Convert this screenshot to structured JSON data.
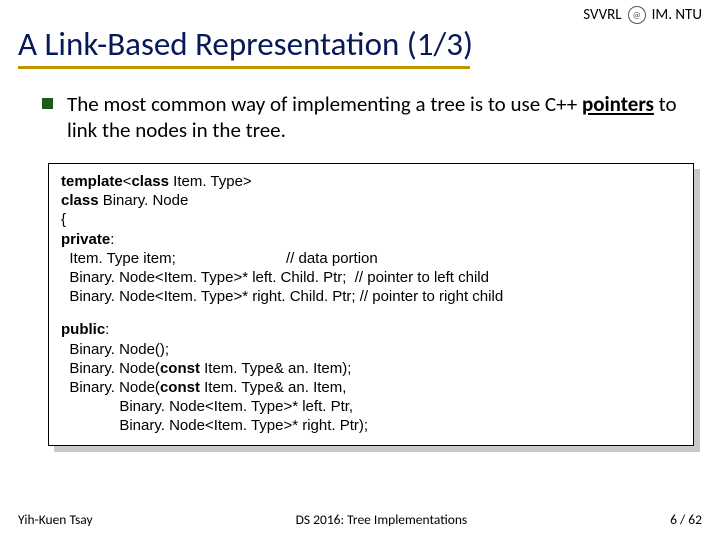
{
  "header": {
    "lab": "SVVRL",
    "at_logo": "@",
    "org": "IM. NTU",
    "title": "A Link-Based Representation (1/3)"
  },
  "bullet": {
    "pre": "The most common way of implementing a tree is to use C++ ",
    "bold": "pointers",
    "post": " to link the nodes in the tree."
  },
  "code": {
    "l1a": "template",
    "l1b": "<",
    "l1c": "class",
    "l1d": " Item. Type>",
    "l2a": "class",
    "l2b": " Binary. Node",
    "l3": "{",
    "l4": "private",
    "l4b": ":",
    "l5a": "  Item. Type item;",
    "l5b": "// data portion",
    "l6": "  Binary. Node<Item. Type>* left. Child. Ptr;  // pointer to left child",
    "l7": "  Binary. Node<Item. Type>* right. Child. Ptr; // pointer to right child",
    "l8": "public",
    "l8b": ":",
    "l9": "  Binary. Node();",
    "l10a": "  Binary. Node(",
    "l10b": "const",
    "l10c": " Item. Type& an. Item);",
    "l11a": "  Binary. Node(",
    "l11b": "const",
    "l11c": " Item. Type& an. Item,",
    "l12": "              Binary. Node<Item. Type>* left. Ptr,",
    "l13": "              Binary. Node<Item. Type>* right. Ptr);"
  },
  "footer": {
    "author": "Yih-Kuen Tsay",
    "course": "DS 2016: Tree Implementations",
    "page": "6 / 62"
  }
}
